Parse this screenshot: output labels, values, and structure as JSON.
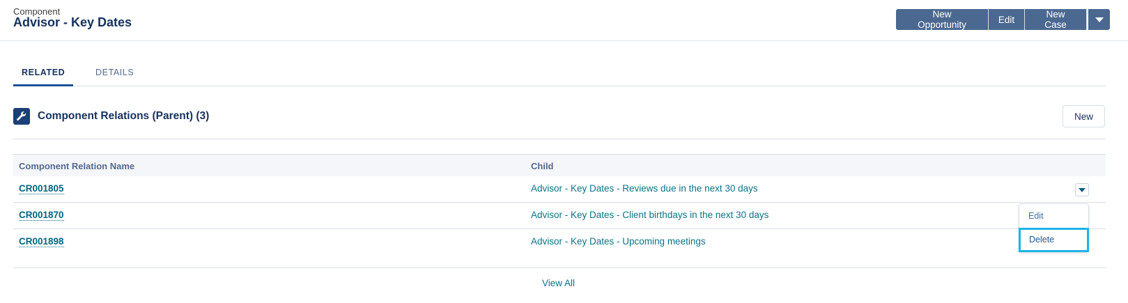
{
  "header": {
    "object_label": "Component",
    "record_title": "Advisor - Key Dates",
    "actions": [
      "New Opportunity",
      "Edit",
      "New Case"
    ],
    "more_icon": "chevron-down-icon"
  },
  "tabs": [
    {
      "label": "RELATED",
      "active": true
    },
    {
      "label": "DETAILS",
      "active": false
    }
  ],
  "related_list": {
    "icon": "wrench-icon",
    "title": "Component Relations (Parent) (3)",
    "new_label": "New",
    "columns": [
      "Component Relation Name",
      "Child"
    ],
    "rows": [
      {
        "name": "CR001805",
        "child": "Advisor - Key Dates - Reviews due in the next 30 days"
      },
      {
        "name": "CR001870",
        "child": "Advisor - Key Dates - Client birthdays in the next 30 days"
      },
      {
        "name": "CR001898",
        "child": "Advisor - Key Dates - Upcoming meetings"
      }
    ],
    "view_all": "View All",
    "row_menu": {
      "items": [
        "Edit",
        "Delete"
      ],
      "focused_item": "Delete"
    }
  },
  "colors": {
    "button_bg": "#4b6890",
    "link": "#0a7385",
    "focus_outline": "#1fb3e8",
    "tab_active": "#1b5297"
  }
}
